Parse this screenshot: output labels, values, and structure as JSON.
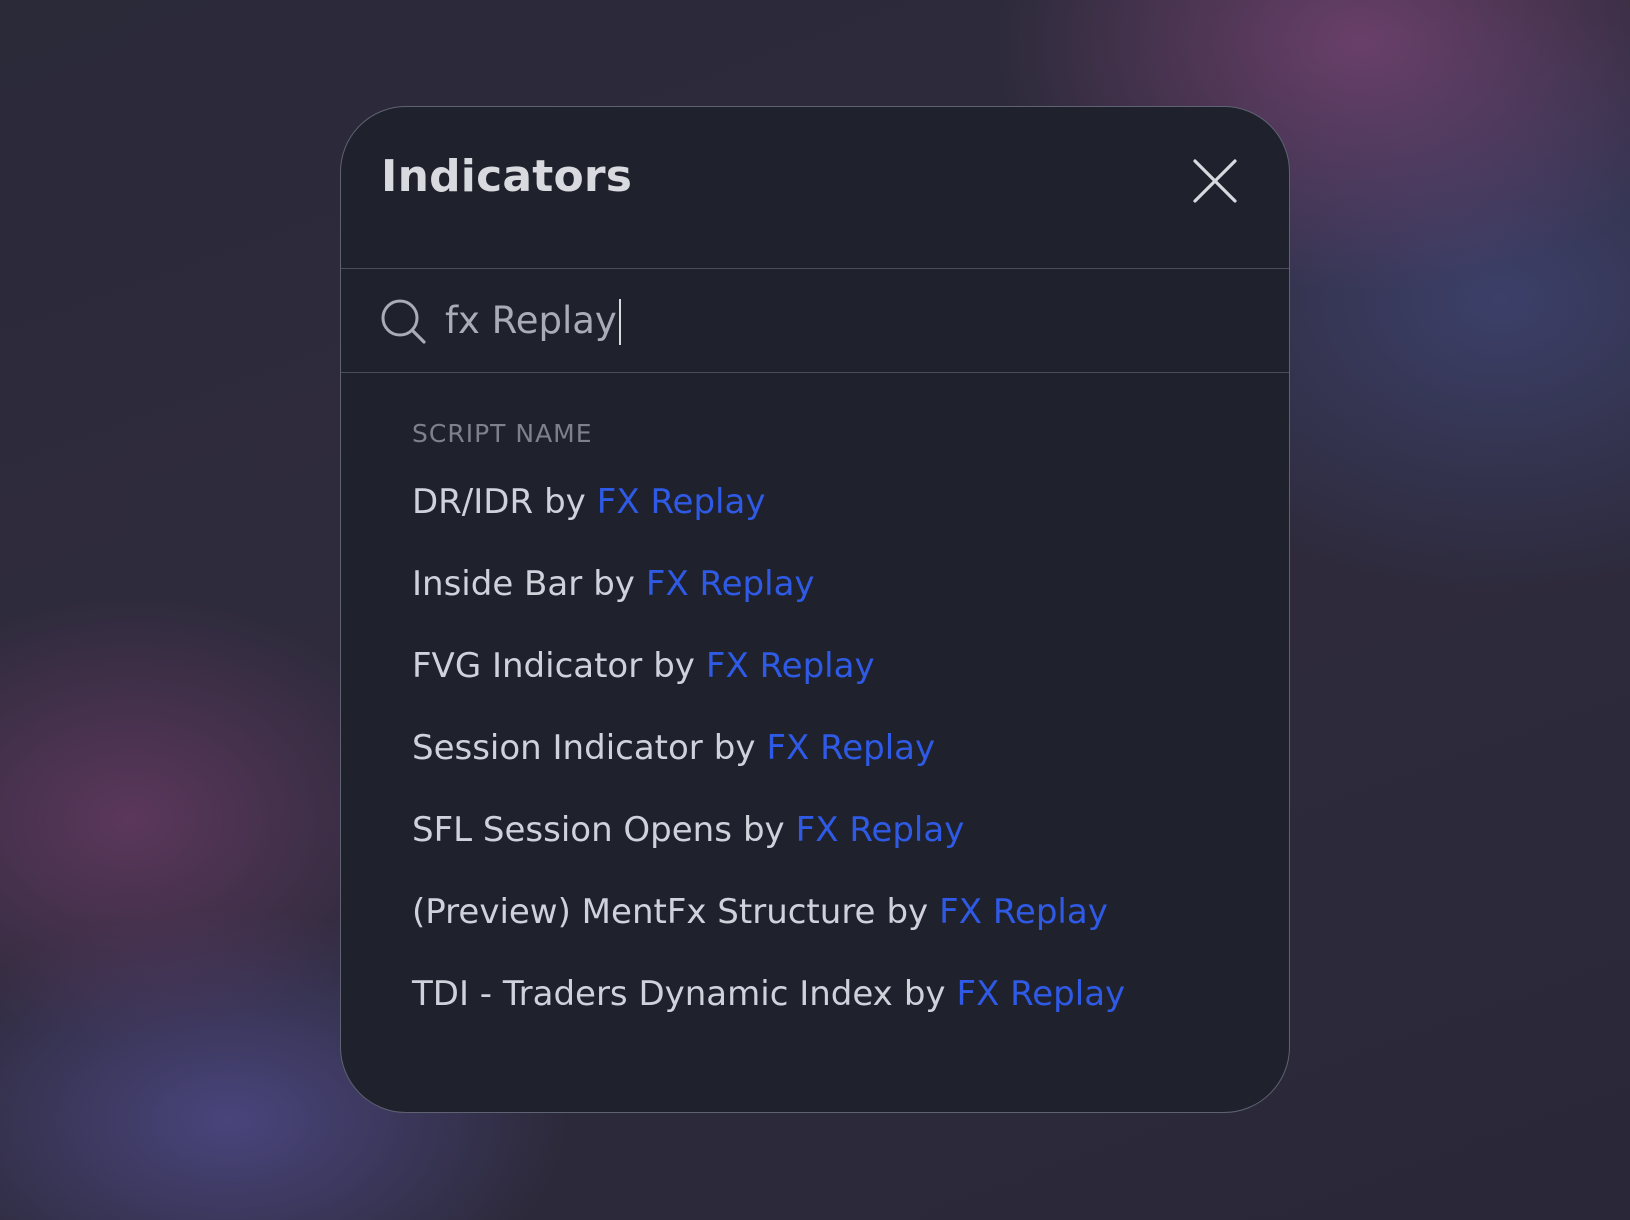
{
  "dialog": {
    "title": "Indicators",
    "close_icon": "close-icon"
  },
  "search": {
    "icon": "search-icon",
    "value": "fx Replay",
    "placeholder": ""
  },
  "results": {
    "section_label": "SCRIPT NAME",
    "by_word": "by",
    "author_color": "#2f5ae6",
    "items": [
      {
        "name": "DR/IDR",
        "author": "FX Replay"
      },
      {
        "name": "Inside Bar",
        "author": "FX Replay"
      },
      {
        "name": "FVG Indicator",
        "author": "FX Replay"
      },
      {
        "name": "Session Indicator",
        "author": "FX Replay"
      },
      {
        "name": "SFL Session Opens",
        "author": "FX Replay"
      },
      {
        "name": "(Preview) MentFx Structure",
        "author": "FX Replay"
      },
      {
        "name": "TDI - Traders Dynamic Index",
        "author": "FX Replay"
      }
    ]
  }
}
